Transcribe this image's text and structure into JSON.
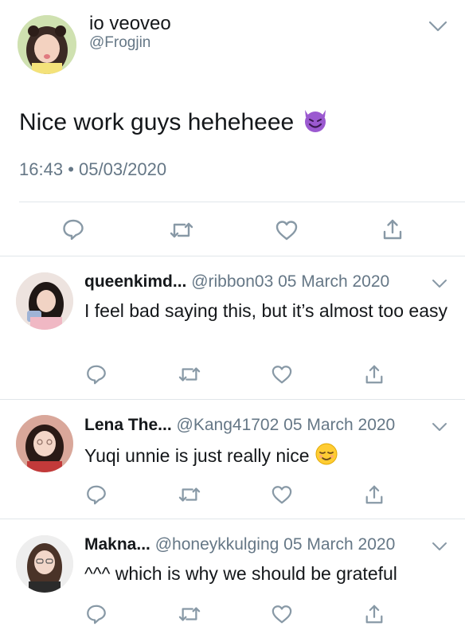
{
  "main_tweet": {
    "display_name": "io veoveo",
    "handle": "@Frogjin",
    "text": "Nice work guys heheheee",
    "text_emoji": "smiling-devil-emoji",
    "time": "16:43",
    "separator": "•",
    "date": "05/03/2020"
  },
  "replies": [
    {
      "name": "queenkimd...",
      "handle": "@ribbon03",
      "date": "05 March 2020",
      "text": "I feel bad saying this, but it’s almost too easy"
    },
    {
      "name": "Lena The...",
      "handle": "@Kang41702",
      "date": "05 March 2020",
      "text": "Yuqi unnie is just really nice",
      "text_emoji": "relieved-face-emoji"
    },
    {
      "name": "Makna...",
      "handle": "@honeykkulging",
      "date": "05 March 2020",
      "text": "^^^ which is why we should be grateful"
    }
  ],
  "icons": {
    "reply": "reply-icon",
    "retweet": "retweet-icon",
    "like": "heart-icon",
    "share": "share-icon",
    "menu": "chevron-down-icon"
  },
  "colors": {
    "text": "#14171a",
    "secondary": "#657786",
    "icon": "#8899a6",
    "divider": "#e1e6ea",
    "devil": "#9b59d0"
  }
}
